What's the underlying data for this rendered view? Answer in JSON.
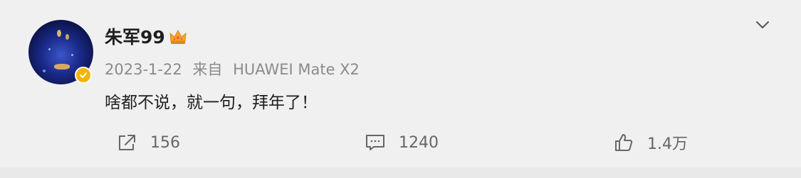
{
  "post": {
    "author": "朱军99",
    "date": "2023-1-22",
    "source_prefix": "来自",
    "source_device": "HUAWEI Mate X2",
    "text": "啥都不说，就一句，拜年了！"
  },
  "actions": {
    "share_count": "156",
    "comment_count": "1240",
    "like_count": "1.4万"
  },
  "icons": {
    "share": "share-icon",
    "comment": "comment-icon",
    "like": "thumbs-up-icon",
    "menu": "chevron-down-icon",
    "badge": "verified-badge-icon",
    "crown": "crown-icon"
  },
  "colors": {
    "background": "#f0f0f1",
    "text_primary": "#1f1f1f",
    "text_secondary": "#8a8a8a",
    "badge": "#f4b400"
  }
}
